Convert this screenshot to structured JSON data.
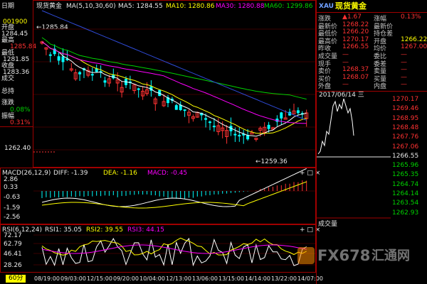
{
  "left_axis": {
    "date_label": "日期",
    "date_value": "001900",
    "open_label": "开盘",
    "open_value": "1284.45",
    "high_label": "最高",
    "high_value": "1285.84",
    "low_label": "最低",
    "low_value": "1281.85",
    "close_label": "收盘",
    "close_value": "1283.36",
    "volume_label": "成交",
    "position_label": "总持",
    "change_label": "涨跌",
    "change_value": "0.08%",
    "amplitude_label": "振幅",
    "amplitude_value": "0.31%",
    "price_level_1262": "1262.40"
  },
  "main_chart": {
    "title": "现货黄金",
    "ma_legend": "MA(5,10,30,60)",
    "ma5": "MA5: 1284.55",
    "ma10": "MA10: 1280.86",
    "ma30": "MA30: 1280.88",
    "ma60": "MA60: 1299.86",
    "high_annotation": "1285.84",
    "low_annotation": "1259.36",
    "tools": "+ □ ×"
  },
  "macd_panel": {
    "label": "MACD(26,12,9)",
    "diff": "DIFF: -1.39",
    "dea": "DEA: -1.16",
    "macd": "MACD: -0.45",
    "levels": [
      "2.86",
      "0.33",
      "-0.63",
      "-1.59",
      "-2.56"
    ],
    "tools": "+ □ ×"
  },
  "rsi_panel": {
    "label": "RSI(6,12,24)",
    "rsi1": "RSI1: 35.05",
    "rsi2": "RSI2: 39.55",
    "rsi3": "RSI3: 44.15",
    "levels": [
      "72.17",
      "62.79",
      "46.41",
      "28.26"
    ],
    "tools": "+ □ ×"
  },
  "x_axis": {
    "period_tab": "60分",
    "dates": [
      "08/19:00",
      "09/03:00",
      "12/15:00",
      "09/20:00",
      "10/04:00",
      "12/13:00",
      "13/06:00",
      "13/15:00",
      "14/14:00",
      "13/22:00",
      "14/07:00"
    ]
  },
  "quote_panel": {
    "code": "XAU",
    "name": "现货黄金",
    "rows": [
      {
        "l1": "涨跌",
        "v1": "▲1.67",
        "l2": "涨幅",
        "v2": "0.13%"
      },
      {
        "l1": "最新价",
        "v1": "1268.22",
        "l2": "最新价",
        "v2": ""
      },
      {
        "l1": "最低价",
        "v1": "1266.20",
        "l2": "持仓差",
        "v2": ""
      },
      {
        "l1": "最高价",
        "v1": "1270.17",
        "l2": "开盘",
        "v2": "1266.22"
      },
      {
        "l1": "昨收",
        "v1": "1266.55",
        "l2": "均价",
        "v2": "1267.00"
      },
      {
        "l1": "成交量",
        "v1": "—",
        "l2": "委比",
        "v2": "—"
      },
      {
        "l1": "现手",
        "v1": "—",
        "l2": "委差",
        "v2": "—"
      },
      {
        "l1": "卖价",
        "v1": "1268.37",
        "l2": "卖量",
        "v2": "—"
      },
      {
        "l1": "买价",
        "v1": "1268.07",
        "l2": "买量",
        "v2": "—"
      },
      {
        "l1": "外盘",
        "v1": "—",
        "l2": "内盘",
        "v2": "—"
      }
    ]
  },
  "intraday_chart": {
    "date": "2017/06/14",
    "weekday": "三",
    "levels": [
      "1270.17",
      "1269.46",
      "1268.95",
      "1268.48",
      "1267.76",
      "1267.06",
      "1266.55",
      "1265.96",
      "1265.35",
      "1264.74",
      "1264.14",
      "1263.54",
      "1262.93"
    ],
    "volume_label": "成交量"
  },
  "watermark": {
    "brand": "FX678",
    "site": "汇通网"
  },
  "colors": {
    "background": "#000000",
    "grid": "#a00000",
    "up": "#ff3232",
    "down": "#00ffff",
    "ma5": "#ffffff",
    "ma10": "#ffff00",
    "ma30": "#ff00ff",
    "ma60": "#00d200",
    "ma_blue": "#2f4bd8"
  }
}
